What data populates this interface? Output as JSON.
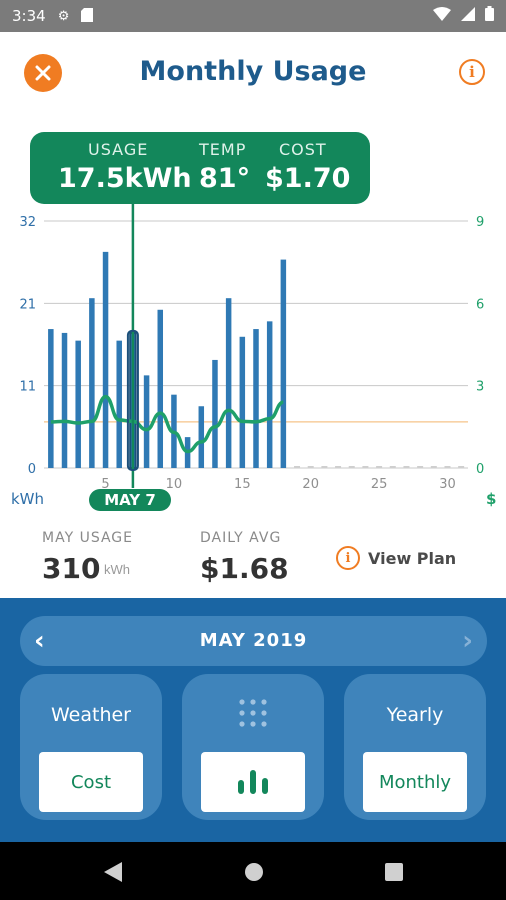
{
  "status_bar": {
    "time": "3:34"
  },
  "header": {
    "title": "Monthly Usage"
  },
  "tooltip": {
    "usage_label": "USAGE",
    "usage_value": "17.5kWh",
    "temp_label": "TEMP",
    "temp_value": "81°",
    "cost_label": "COST",
    "cost_value": "$1.70"
  },
  "selected_day_label": "MAY 7",
  "chart_data": {
    "type": "bar",
    "x": [
      1,
      2,
      3,
      4,
      5,
      6,
      7,
      8,
      9,
      10,
      11,
      12,
      13,
      14,
      15,
      16,
      17,
      18,
      19,
      20,
      21,
      22,
      23,
      24,
      25,
      26,
      27,
      28,
      29,
      30,
      31
    ],
    "series": [
      {
        "name": "kWh",
        "values": [
          18,
          17.5,
          16.5,
          22,
          28,
          16.5,
          17.5,
          12,
          20.5,
          9.5,
          4,
          8,
          14,
          22,
          17,
          18,
          19,
          27,
          0,
          0,
          0,
          0,
          0,
          0,
          0,
          0,
          0,
          0,
          0,
          0,
          0
        ]
      },
      {
        "name": "$",
        "values": [
          1.68,
          1.7,
          1.64,
          1.7,
          2.6,
          1.75,
          1.7,
          1.4,
          2.0,
          1.3,
          0.6,
          0.95,
          1.5,
          2.1,
          1.7,
          1.68,
          1.8,
          2.4
        ]
      }
    ],
    "y_left_ticks": [
      "32",
      "21",
      "11",
      "0"
    ],
    "y_right_ticks": [
      "9",
      "6",
      "3",
      "0"
    ],
    "x_ticks": [
      "5",
      "10",
      "15",
      "20",
      "25",
      "30"
    ],
    "xlim": [
      0.5,
      31.5
    ],
    "ylim_left": [
      0,
      32
    ],
    "ylim_right": [
      0,
      9
    ],
    "average_line_right": 1.68,
    "selected_index": 6,
    "ylabel_left": "kWh",
    "ylabel_right": "$",
    "colors": {
      "bars": "#2f79b4",
      "line": "#1fa06a",
      "average": "#f5c48a",
      "grid": "#c8c8c8",
      "left_axis": "#2f6fa8",
      "right_axis": "#1fa06a"
    }
  },
  "stats": {
    "usage_label": "MAY USAGE",
    "usage_value": "310",
    "usage_unit": "kWh",
    "avg_label": "DAILY AVG",
    "avg_value": "$1.68",
    "view_plan": "View Plan"
  },
  "month_nav": {
    "label": "MAY 2019"
  },
  "tiles": [
    {
      "title": "Weather",
      "button": "Cost"
    },
    {
      "title": "",
      "button": ""
    },
    {
      "title": "Yearly",
      "button": "Monthly"
    }
  ]
}
